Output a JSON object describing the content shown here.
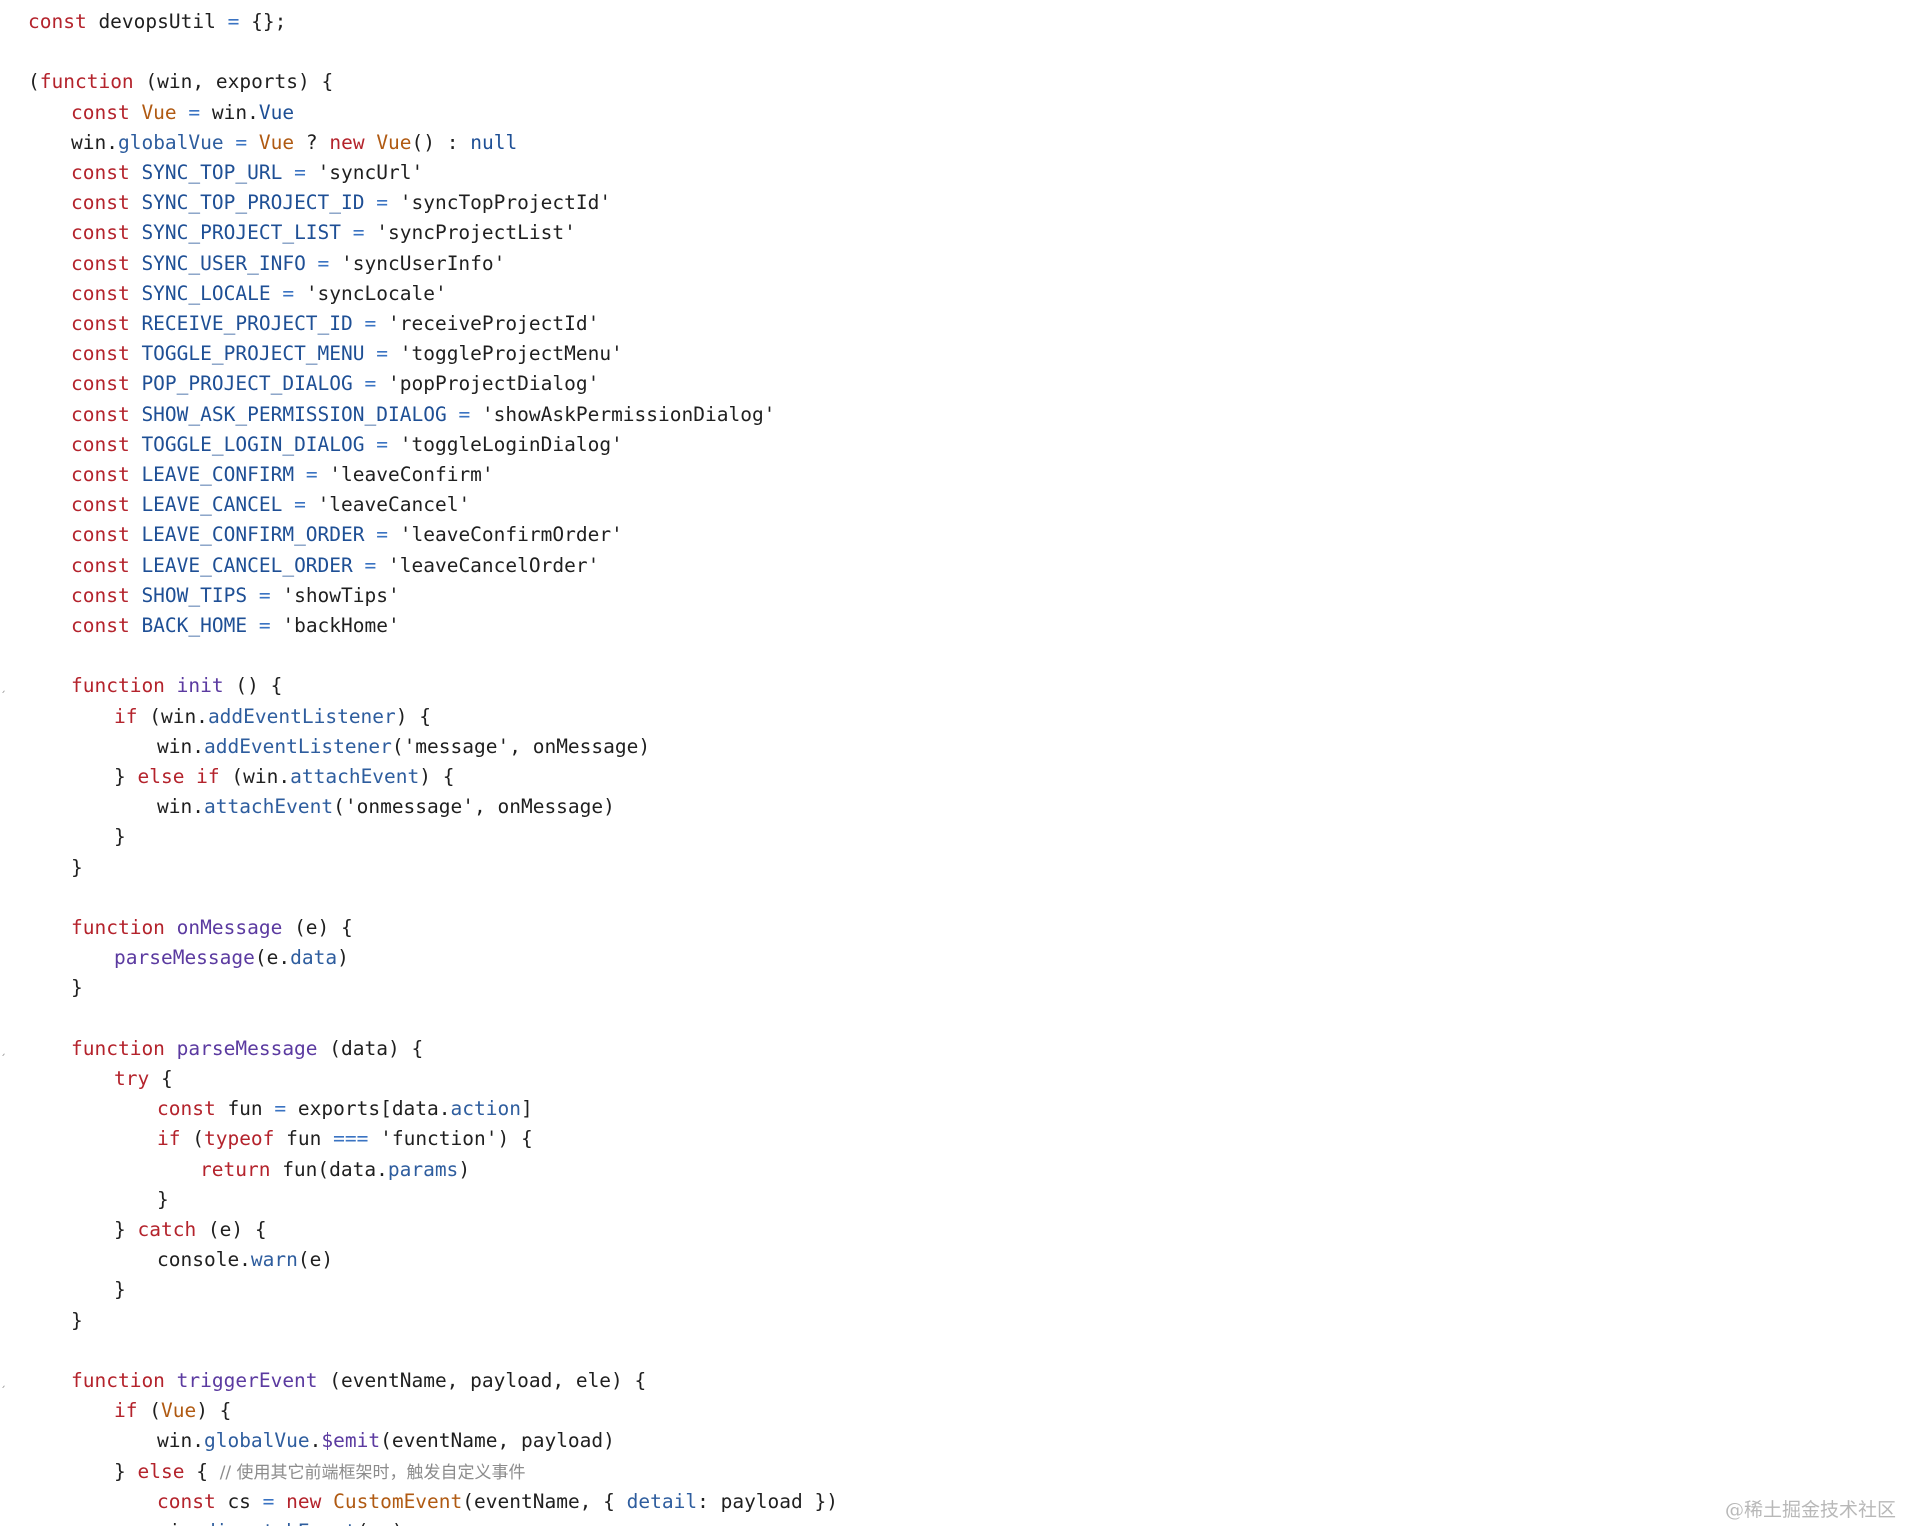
{
  "code": {
    "lines": [
      {
        "indent": 0,
        "tokens": [
          [
            "kw",
            "const"
          ],
          [
            "id",
            " devopsUtil "
          ],
          [
            "op",
            "="
          ],
          [
            "pn",
            " {};"
          ]
        ]
      },
      {
        "indent": 0,
        "tokens": []
      },
      {
        "indent": 0,
        "tokens": [
          [
            "pn",
            "("
          ],
          [
            "kw",
            "function"
          ],
          [
            "pn",
            " (win, exports) {"
          ]
        ]
      },
      {
        "indent": 1,
        "tokens": [
          [
            "kw",
            "const"
          ],
          [
            "vu",
            " Vue "
          ],
          [
            "op",
            "="
          ],
          [
            "pn",
            " win."
          ],
          [
            "cn",
            "Vue"
          ]
        ]
      },
      {
        "indent": 1,
        "tokens": [
          [
            "pn",
            "win."
          ],
          [
            "pr",
            "globalVue"
          ],
          [
            "op",
            " = "
          ],
          [
            "vu",
            "Vue"
          ],
          [
            "pn",
            " ? "
          ],
          [
            "kw",
            "new"
          ],
          [
            "vu",
            " Vue"
          ],
          [
            "pn",
            "() : "
          ],
          [
            "nl",
            "null"
          ]
        ]
      },
      {
        "indent": 1,
        "tokens": [
          [
            "kw",
            "const"
          ],
          [
            "cn",
            " SYNC_TOP_URL "
          ],
          [
            "op",
            "="
          ],
          [
            "st",
            " 'syncUrl'"
          ]
        ]
      },
      {
        "indent": 1,
        "tokens": [
          [
            "kw",
            "const"
          ],
          [
            "cn",
            " SYNC_TOP_PROJECT_ID "
          ],
          [
            "op",
            "="
          ],
          [
            "st",
            " 'syncTopProjectId'"
          ]
        ]
      },
      {
        "indent": 1,
        "tokens": [
          [
            "kw",
            "const"
          ],
          [
            "cn",
            " SYNC_PROJECT_LIST "
          ],
          [
            "op",
            "="
          ],
          [
            "st",
            " 'syncProjectList'"
          ]
        ]
      },
      {
        "indent": 1,
        "tokens": [
          [
            "kw",
            "const"
          ],
          [
            "cn",
            " SYNC_USER_INFO "
          ],
          [
            "op",
            "="
          ],
          [
            "st",
            " 'syncUserInfo'"
          ]
        ]
      },
      {
        "indent": 1,
        "tokens": [
          [
            "kw",
            "const"
          ],
          [
            "cn",
            " SYNC_LOCALE "
          ],
          [
            "op",
            "="
          ],
          [
            "st",
            " 'syncLocale'"
          ]
        ]
      },
      {
        "indent": 1,
        "tokens": [
          [
            "kw",
            "const"
          ],
          [
            "cn",
            " RECEIVE_PROJECT_ID "
          ],
          [
            "op",
            "="
          ],
          [
            "st",
            " 'receiveProjectId'"
          ]
        ]
      },
      {
        "indent": 1,
        "tokens": [
          [
            "kw",
            "const"
          ],
          [
            "cn",
            " TOGGLE_PROJECT_MENU "
          ],
          [
            "op",
            "="
          ],
          [
            "st",
            " 'toggleProjectMenu'"
          ]
        ]
      },
      {
        "indent": 1,
        "tokens": [
          [
            "kw",
            "const"
          ],
          [
            "cn",
            " POP_PROJECT_DIALOG "
          ],
          [
            "op",
            "="
          ],
          [
            "st",
            " 'popProjectDialog'"
          ]
        ]
      },
      {
        "indent": 1,
        "tokens": [
          [
            "kw",
            "const"
          ],
          [
            "cn",
            " SHOW_ASK_PERMISSION_DIALOG "
          ],
          [
            "op",
            "="
          ],
          [
            "st",
            " 'showAskPermissionDialog'"
          ]
        ]
      },
      {
        "indent": 1,
        "tokens": [
          [
            "kw",
            "const"
          ],
          [
            "cn",
            " TOGGLE_LOGIN_DIALOG "
          ],
          [
            "op",
            "="
          ],
          [
            "st",
            " 'toggleLoginDialog'"
          ]
        ]
      },
      {
        "indent": 1,
        "tokens": [
          [
            "kw",
            "const"
          ],
          [
            "cn",
            " LEAVE_CONFIRM "
          ],
          [
            "op",
            "="
          ],
          [
            "st",
            " 'leaveConfirm'"
          ]
        ]
      },
      {
        "indent": 1,
        "tokens": [
          [
            "kw",
            "const"
          ],
          [
            "cn",
            " LEAVE_CANCEL "
          ],
          [
            "op",
            "="
          ],
          [
            "st",
            " 'leaveCancel'"
          ]
        ]
      },
      {
        "indent": 1,
        "tokens": [
          [
            "kw",
            "const"
          ],
          [
            "cn",
            " LEAVE_CONFIRM_ORDER "
          ],
          [
            "op",
            "="
          ],
          [
            "st",
            " 'leaveConfirmOrder'"
          ]
        ]
      },
      {
        "indent": 1,
        "tokens": [
          [
            "kw",
            "const"
          ],
          [
            "cn",
            " LEAVE_CANCEL_ORDER "
          ],
          [
            "op",
            "="
          ],
          [
            "st",
            " 'leaveCancelOrder'"
          ]
        ]
      },
      {
        "indent": 1,
        "tokens": [
          [
            "kw",
            "const"
          ],
          [
            "cn",
            " SHOW_TIPS "
          ],
          [
            "op",
            "="
          ],
          [
            "st",
            " 'showTips'"
          ]
        ]
      },
      {
        "indent": 1,
        "tokens": [
          [
            "kw",
            "const"
          ],
          [
            "cn",
            " BACK_HOME "
          ],
          [
            "op",
            "="
          ],
          [
            "st",
            " 'backHome'"
          ]
        ]
      },
      {
        "indent": 0,
        "tokens": []
      },
      {
        "indent": 1,
        "fold": true,
        "tokens": [
          [
            "kw",
            "function"
          ],
          [
            "fn",
            " init"
          ],
          [
            "pn",
            " () {"
          ]
        ]
      },
      {
        "indent": 2,
        "tokens": [
          [
            "kw",
            "if"
          ],
          [
            "pn",
            " (win."
          ],
          [
            "pr",
            "addEventListener"
          ],
          [
            "pn",
            ") {"
          ]
        ]
      },
      {
        "indent": 3,
        "tokens": [
          [
            "pn",
            "win."
          ],
          [
            "pr",
            "addEventListener"
          ],
          [
            "pn",
            "("
          ],
          [
            "st",
            "'message'"
          ],
          [
            "pn",
            ", onMessage)"
          ]
        ]
      },
      {
        "indent": 2,
        "tokens": [
          [
            "pn",
            "} "
          ],
          [
            "kw",
            "else if"
          ],
          [
            "pn",
            " (win."
          ],
          [
            "pr",
            "attachEvent"
          ],
          [
            "pn",
            ") {"
          ]
        ]
      },
      {
        "indent": 3,
        "tokens": [
          [
            "pn",
            "win."
          ],
          [
            "pr",
            "attachEvent"
          ],
          [
            "pn",
            "("
          ],
          [
            "st",
            "'onmessage'"
          ],
          [
            "pn",
            ", onMessage)"
          ]
        ]
      },
      {
        "indent": 2,
        "tokens": [
          [
            "pn",
            "}"
          ]
        ]
      },
      {
        "indent": 1,
        "tokens": [
          [
            "pn",
            "}"
          ]
        ]
      },
      {
        "indent": 0,
        "tokens": []
      },
      {
        "indent": 1,
        "tokens": [
          [
            "kw",
            "function"
          ],
          [
            "fn",
            " onMessage"
          ],
          [
            "pn",
            " (e) {"
          ]
        ]
      },
      {
        "indent": 2,
        "tokens": [
          [
            "fn",
            "parseMessage"
          ],
          [
            "pn",
            "(e."
          ],
          [
            "pr",
            "data"
          ],
          [
            "pn",
            ")"
          ]
        ]
      },
      {
        "indent": 1,
        "tokens": [
          [
            "pn",
            "}"
          ]
        ]
      },
      {
        "indent": 0,
        "tokens": []
      },
      {
        "indent": 1,
        "fold": true,
        "tokens": [
          [
            "kw",
            "function"
          ],
          [
            "fn",
            " parseMessage"
          ],
          [
            "pn",
            " (data) {"
          ]
        ]
      },
      {
        "indent": 2,
        "tokens": [
          [
            "kw",
            "try"
          ],
          [
            "pn",
            " {"
          ]
        ]
      },
      {
        "indent": 3,
        "tokens": [
          [
            "kw",
            "const"
          ],
          [
            "id",
            " fun "
          ],
          [
            "op",
            "="
          ],
          [
            "pn",
            " exports[data."
          ],
          [
            "pr",
            "action"
          ],
          [
            "pn",
            "]"
          ]
        ]
      },
      {
        "indent": 3,
        "tokens": [
          [
            "kw",
            "if"
          ],
          [
            "pn",
            " ("
          ],
          [
            "kw",
            "typeof"
          ],
          [
            "pn",
            " fun "
          ],
          [
            "op",
            "==="
          ],
          [
            "st",
            " 'function'"
          ],
          [
            "pn",
            ") {"
          ]
        ]
      },
      {
        "indent": 4,
        "tokens": [
          [
            "kw",
            "return"
          ],
          [
            "pn",
            " fun(data."
          ],
          [
            "pr",
            "params"
          ],
          [
            "pn",
            ")"
          ]
        ]
      },
      {
        "indent": 3,
        "tokens": [
          [
            "pn",
            "}"
          ]
        ]
      },
      {
        "indent": 2,
        "tokens": [
          [
            "pn",
            "} "
          ],
          [
            "kw",
            "catch"
          ],
          [
            "pn",
            " (e) {"
          ]
        ]
      },
      {
        "indent": 3,
        "tokens": [
          [
            "pn",
            "console."
          ],
          [
            "pr",
            "warn"
          ],
          [
            "pn",
            "(e)"
          ]
        ]
      },
      {
        "indent": 2,
        "tokens": [
          [
            "pn",
            "}"
          ]
        ]
      },
      {
        "indent": 1,
        "tokens": [
          [
            "pn",
            "}"
          ]
        ]
      },
      {
        "indent": 0,
        "tokens": []
      },
      {
        "indent": 1,
        "fold": true,
        "tokens": [
          [
            "kw",
            "function"
          ],
          [
            "fn",
            " triggerEvent"
          ],
          [
            "pn",
            " (eventName, payload, ele) {"
          ]
        ]
      },
      {
        "indent": 2,
        "tokens": [
          [
            "kw",
            "if"
          ],
          [
            "pn",
            " ("
          ],
          [
            "vu",
            "Vue"
          ],
          [
            "pn",
            ") {"
          ]
        ]
      },
      {
        "indent": 3,
        "tokens": [
          [
            "pn",
            "win."
          ],
          [
            "pr",
            "globalVue"
          ],
          [
            "pn",
            "."
          ],
          [
            "fn",
            "$emit"
          ],
          [
            "pn",
            "(eventName, payload)"
          ]
        ]
      },
      {
        "indent": 2,
        "tokens": [
          [
            "pn",
            "} "
          ],
          [
            "kw",
            "else"
          ],
          [
            "pn",
            " { "
          ],
          [
            "cm",
            "// 使用其它前端框架时，触发自定义事件"
          ]
        ]
      },
      {
        "indent": 3,
        "tokens": [
          [
            "kw",
            "const"
          ],
          [
            "id",
            " cs "
          ],
          [
            "op",
            "="
          ],
          [
            "kw",
            " new"
          ],
          [
            "vu",
            " CustomEvent"
          ],
          [
            "pn",
            "(eventName, { "
          ],
          [
            "pr",
            "detail"
          ],
          [
            "pn",
            ": payload })"
          ]
        ]
      },
      {
        "indent": 3,
        "tokens": [
          [
            "pn",
            "win."
          ],
          [
            "pr",
            "dispatchEvent"
          ],
          [
            "pn",
            "(cs)"
          ]
        ]
      }
    ]
  },
  "watermark": {
    "text": "@稀土掘金技术社区"
  }
}
